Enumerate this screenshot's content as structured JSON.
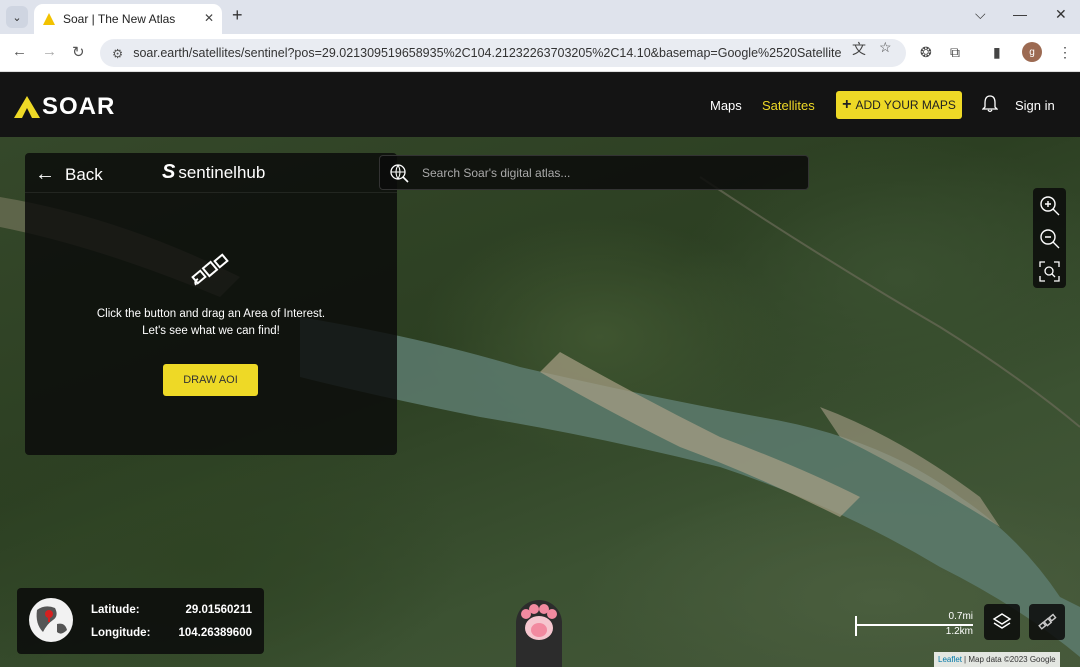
{
  "browser": {
    "tab_title": "Soar | The New Atlas",
    "url": "soar.earth/satellites/sentinel?pos=29.021309519658935%2C104.21232263703205%2C14.10&basemap=Google%2520Satellite"
  },
  "header": {
    "logo_text": "SOAR",
    "nav": [
      "Maps",
      "Satellites"
    ],
    "add_maps_label": "ADD YOUR MAPS",
    "sign_in_label": "Sign in",
    "accent_color": "#eed926",
    "active_nav_color": "#eed926"
  },
  "panel": {
    "back_label": "Back",
    "provider": "sentinelhub",
    "message_line1": "Click the button and drag an Area of Interest.",
    "message_line2": "Let's see what we can find!",
    "draw_label": "DRAW AOI"
  },
  "search": {
    "placeholder": "Search Soar's digital atlas..."
  },
  "coords": {
    "lat_label": "Latitude:",
    "lat_value": "29.01560211",
    "lon_label": "Longitude:",
    "lon_value": "104.26389600"
  },
  "scale": {
    "mi": "0.7mi",
    "km": "1.2km"
  },
  "attribution": {
    "leaflet": "Leaflet",
    "text": " | Map data ©2023 Google"
  },
  "icons": [
    "warning-favicon",
    "tune-icon",
    "translate-icon",
    "star-icon",
    "extension-icon",
    "sidebar-icon",
    "bell-icon",
    "satellite-icon",
    "globe-icon",
    "zoom-in-icon",
    "zoom-out-icon",
    "zoom-area-icon",
    "layers-icon",
    "satellite-tool-icon",
    "paw-icon"
  ]
}
